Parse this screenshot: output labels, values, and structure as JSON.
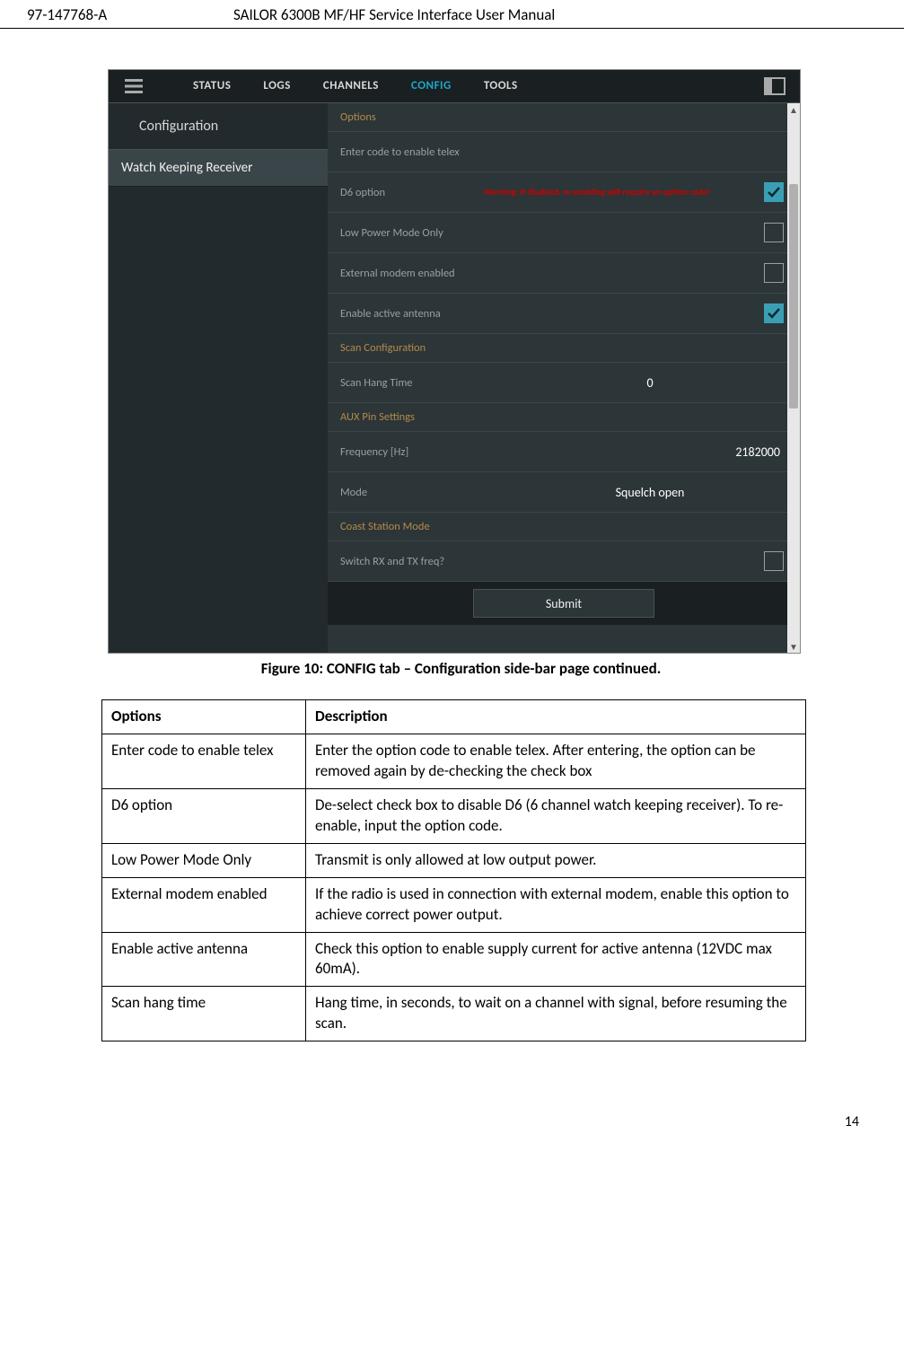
{
  "header": {
    "doc_number": "97-147768-A",
    "doc_title": "SAILOR 6300B MF/HF Service Interface User Manual"
  },
  "app": {
    "tabs": [
      "STATUS",
      "LOGS",
      "CHANNELS",
      "CONFIG",
      "TOOLS"
    ],
    "active_tab": "CONFIG",
    "sidebar": {
      "title": "Configuration",
      "selected": "Watch Keeping Receiver"
    },
    "sections": {
      "options": {
        "title": "Options",
        "telex_label": "Enter code to enable telex",
        "d6_label": "D6 option",
        "d6_warning": "Warning: if disabled, re-enabling will require an option code!",
        "d6_checked": true,
        "lowpower_label": "Low Power Mode Only",
        "lowpower_checked": false,
        "modem_label": "External modem enabled",
        "modem_checked": false,
        "antenna_label": "Enable active antenna",
        "antenna_checked": true
      },
      "scan": {
        "title": "Scan Configuration",
        "hang_label": "Scan Hang Time",
        "hang_value": "0"
      },
      "aux": {
        "title": "AUX Pin Settings",
        "freq_label": "Frequency [Hz]",
        "freq_value": "2182000",
        "mode_label": "Mode",
        "mode_value": "Squelch open"
      },
      "coast": {
        "title": "Coast Station Mode",
        "switch_label": "Switch RX and TX freq?",
        "switch_checked": false
      }
    },
    "submit": "Submit"
  },
  "figure_caption": "Figure 10: CONFIG tab – Configuration side-bar page continued.",
  "table": {
    "header": {
      "col1": "Options",
      "col2": "Description"
    },
    "rows": [
      {
        "opt": "Enter code to enable telex",
        "desc": "Enter the option code to enable telex. After entering, the option can be removed again by de-checking the check box"
      },
      {
        "opt": "D6 option",
        "desc": "De-select check box to disable D6 (6 channel watch keeping receiver). To re-enable, input the option code."
      },
      {
        "opt": "Low Power Mode Only",
        "desc": "Transmit is only allowed at low output power."
      },
      {
        "opt": "External modem enabled",
        "desc": "If the radio is used in connection with external modem, enable this option to achieve correct power output."
      },
      {
        "opt": "Enable active antenna",
        "desc": "Check this option to enable supply current for active antenna (12VDC max 60mA)."
      },
      {
        "opt": "Scan hang time",
        "desc": "Hang time, in seconds, to wait on a channel with signal, before resuming the scan."
      }
    ]
  },
  "page_number": "14"
}
